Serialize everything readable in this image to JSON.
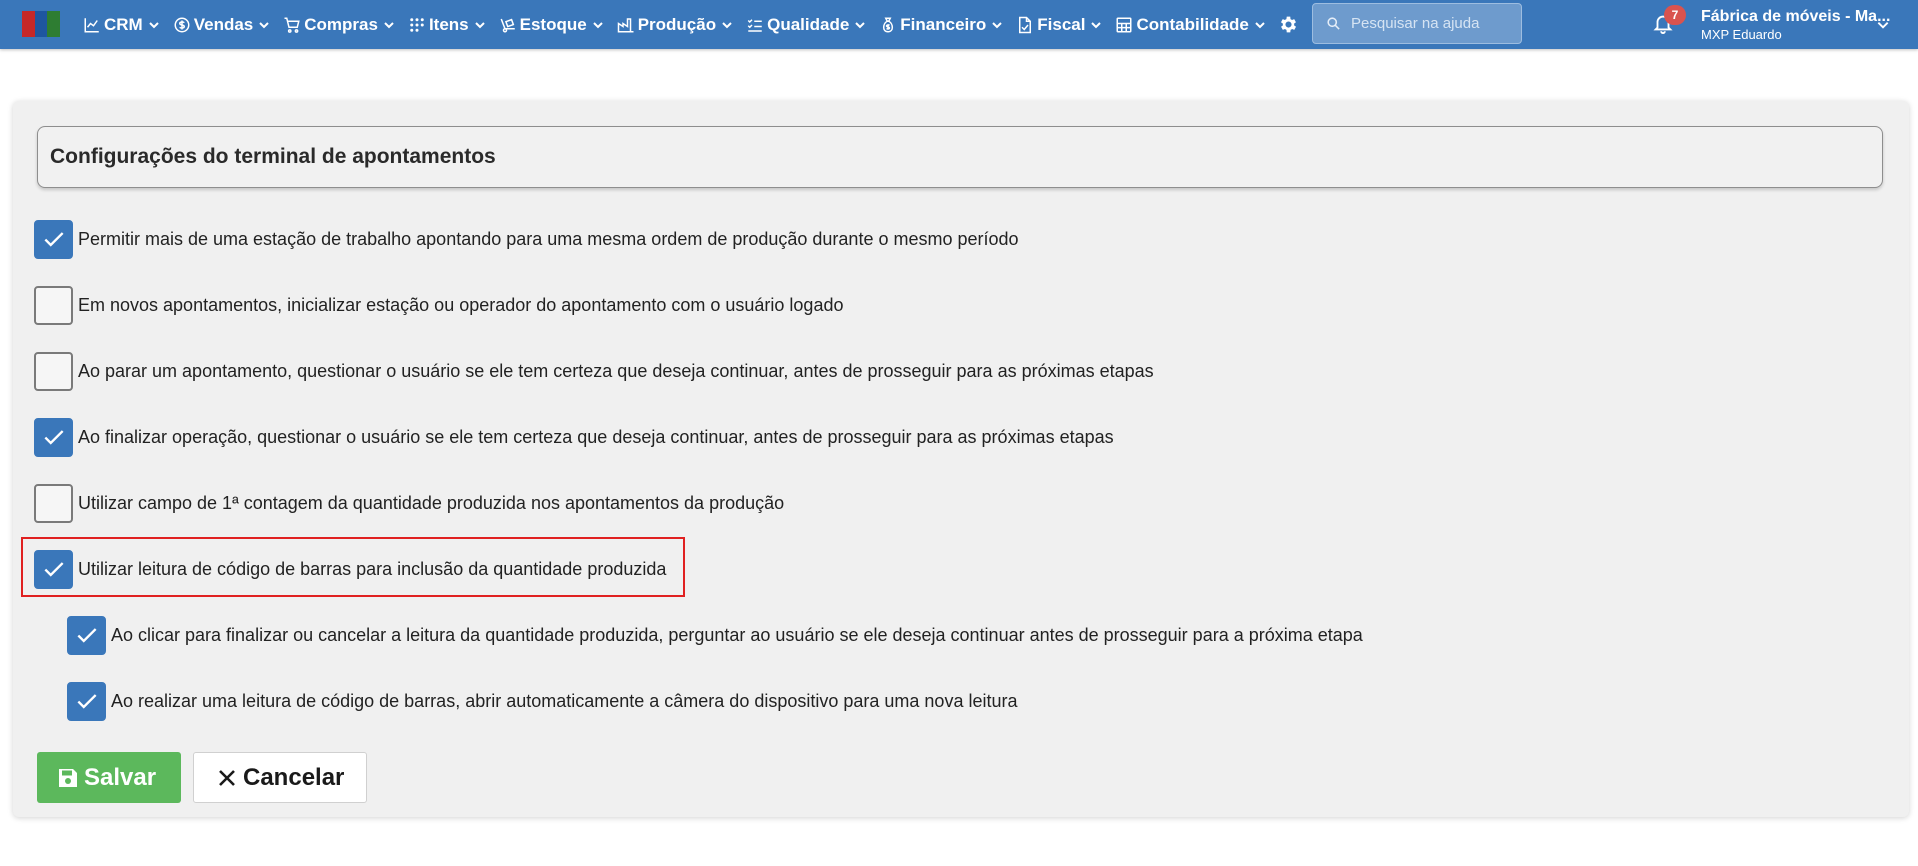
{
  "nav": {
    "items": [
      {
        "label": "CRM",
        "icon": "chart-line-icon"
      },
      {
        "label": "Vendas",
        "icon": "dollar-circle-icon"
      },
      {
        "label": "Compras",
        "icon": "cart-icon"
      },
      {
        "label": "Itens",
        "icon": "grid-dots-icon"
      },
      {
        "label": "Estoque",
        "icon": "dolly-icon"
      },
      {
        "label": "Produção",
        "icon": "factory-icon"
      },
      {
        "label": "Qualidade",
        "icon": "checklist-icon"
      },
      {
        "label": "Financeiro",
        "icon": "money-bag-icon"
      },
      {
        "label": "Fiscal",
        "icon": "document-check-icon"
      },
      {
        "label": "Contabilidade",
        "icon": "calculator-icon"
      }
    ],
    "tools": [
      "gear-icon",
      "help-circle-icon",
      "chat-icon"
    ]
  },
  "search": {
    "placeholder": "Pesquisar na ajuda"
  },
  "notifications": {
    "count": "7"
  },
  "account": {
    "company": "Fábrica de móveis - Ma...",
    "user": "MXP Eduardo"
  },
  "page": {
    "title": "Configurações do terminal de apontamentos"
  },
  "options": [
    {
      "label": "Permitir mais de uma estação de trabalho apontando para uma mesma ordem de produção durante o mesmo período",
      "checked": true
    },
    {
      "label": "Em novos apontamentos, inicializar estação ou operador do apontamento com o usuário logado",
      "checked": false
    },
    {
      "label": "Ao parar um apontamento, questionar o usuário se ele tem certeza que deseja continuar, antes de prosseguir para as próximas etapas",
      "checked": false
    },
    {
      "label": "Ao finalizar operação, questionar o usuário se ele tem certeza que deseja continuar, antes de prosseguir para as próximas etapas",
      "checked": true
    },
    {
      "label": "Utilizar campo de 1ª contagem da quantidade produzida nos apontamentos da produção",
      "checked": false
    },
    {
      "label": "Utilizar leitura de código de barras para inclusão da quantidade produzida",
      "checked": true
    },
    {
      "label": "Ao clicar para finalizar ou cancelar a leitura da quantidade produzida, perguntar ao usuário se ele deseja continuar antes de prosseguir para a próxima etapa",
      "checked": true
    },
    {
      "label": "Ao realizar uma leitura de código de barras, abrir automaticamente a câmera do dispositivo para uma nova leitura",
      "checked": true
    }
  ],
  "buttons": {
    "save": "Salvar",
    "cancel": "Cancelar"
  },
  "colors": {
    "nav": "#3a77ba",
    "checkbox": "#3a77ba",
    "save": "#5cb85c",
    "highlight": "#e02020",
    "badge": "#d9534f"
  }
}
